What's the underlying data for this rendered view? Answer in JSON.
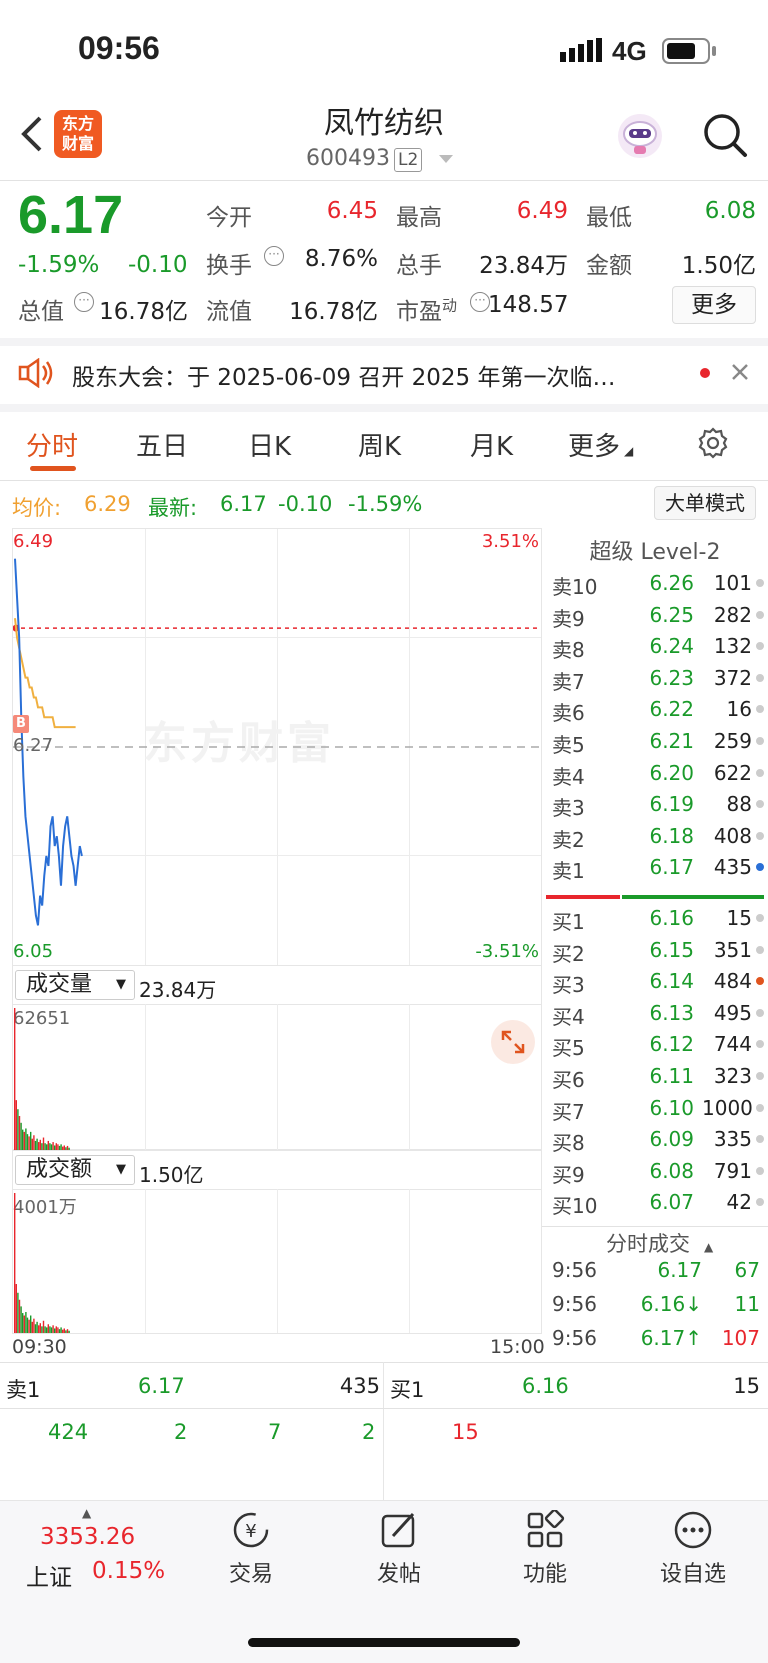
{
  "status": {
    "time": "09:56",
    "network": "4G"
  },
  "header": {
    "logo_line1": "东方",
    "logo_line2": "财富",
    "title": "凤竹纺织",
    "code": "600493",
    "level": "L2"
  },
  "quote": {
    "price": "6.17",
    "change_pct": "-1.59%",
    "change": "-0.10",
    "open_label": "今开",
    "open": "6.45",
    "high_label": "最高",
    "high": "6.49",
    "low_label": "最低",
    "low": "6.08",
    "turnover_label": "换手",
    "turnover": "8.76%",
    "volume_label": "总手",
    "volume": "23.84万",
    "amount_label": "金额",
    "amount": "1.50亿",
    "mktcap_label": "总值",
    "mktcap": "16.78亿",
    "float_label": "流值",
    "float": "16.78亿",
    "pe_label": "市盈",
    "pe_sup": "动",
    "pe": "148.57",
    "more_button": "更多"
  },
  "notice": {
    "text": "股东大会：于 2025-06-09 召开 2025 年第一次临…"
  },
  "tabs": [
    "分时",
    "五日",
    "日K",
    "周K",
    "月K",
    "更多"
  ],
  "chart_info": {
    "avg_label": "均价:",
    "avg": "6.29",
    "latest_label": "最新:",
    "latest": "6.17",
    "latest_change": "-0.10",
    "latest_pct": "-1.59%",
    "mode_button": "大单模式"
  },
  "chart_data": {
    "type": "line",
    "y_top": "6.49",
    "y_mid": "6.27",
    "y_bottom": "6.05",
    "pct_top": "3.51%",
    "pct_bottom": "-3.51%",
    "time_start": "09:30",
    "time_end": "15:00",
    "watermark": "东方财富",
    "marker": "B",
    "price_line": [
      6.46,
      6.42,
      6.38,
      6.3,
      6.24,
      6.2,
      6.18,
      6.16,
      6.14,
      6.12,
      6.1,
      6.09,
      6.12,
      6.11,
      6.14,
      6.16,
      6.15,
      6.19,
      6.2,
      6.17,
      6.18,
      6.16,
      6.13,
      6.17,
      6.19,
      6.2,
      6.18,
      6.16,
      6.15,
      6.13,
      6.15,
      6.17,
      6.16
    ],
    "avg_line": [
      6.4,
      6.38,
      6.37,
      6.36,
      6.35,
      6.34,
      6.34,
      6.33,
      6.33,
      6.32,
      6.32,
      6.31,
      6.31,
      6.31,
      6.3,
      6.3,
      6.3,
      6.3,
      6.3,
      6.29,
      6.29,
      6.29,
      6.29,
      6.29,
      6.29,
      6.29,
      6.29,
      6.29,
      6.29,
      6.29
    ],
    "prev_close": 6.27,
    "last_price": 6.17,
    "y_range": [
      6.05,
      6.49
    ]
  },
  "volume_panel": {
    "label": "成交量",
    "value": "23.84万",
    "max": "62651",
    "bars": [
      62651,
      22000,
      18000,
      15000,
      12000,
      9000,
      8000,
      9500,
      7000,
      6000,
      8000,
      5000,
      6500,
      4000,
      5000,
      3500,
      4500,
      3000,
      5500,
      3000,
      2500,
      4000,
      3000,
      2500,
      3500,
      2000,
      3000,
      2500,
      1800,
      2500,
      1500,
      2000,
      1200,
      1800,
      1000
    ]
  },
  "amount_panel": {
    "label": "成交额",
    "value": "1.50亿",
    "max": "4001万",
    "bars": [
      40010,
      14000,
      11500,
      9500,
      7600,
      5700,
      5000,
      6000,
      4400,
      3800,
      5000,
      3200,
      4100,
      2500,
      3200,
      2200,
      2800,
      1900,
      3500,
      1900,
      1600,
      2500,
      1900,
      1600,
      2200,
      1300,
      1900,
      1600,
      1100,
      1600,
      950,
      1300,
      760,
      1100,
      640
    ]
  },
  "orderbook": {
    "title": "超级 Level-2",
    "asks": [
      {
        "label": "卖10",
        "price": "6.26",
        "vol": "101"
      },
      {
        "label": "卖9",
        "price": "6.25",
        "vol": "282"
      },
      {
        "label": "卖8",
        "price": "6.24",
        "vol": "132"
      },
      {
        "label": "卖7",
        "price": "6.23",
        "vol": "372"
      },
      {
        "label": "卖6",
        "price": "6.22",
        "vol": "16"
      },
      {
        "label": "卖5",
        "price": "6.21",
        "vol": "259"
      },
      {
        "label": "卖4",
        "price": "6.20",
        "vol": "622"
      },
      {
        "label": "卖3",
        "price": "6.19",
        "vol": "88"
      },
      {
        "label": "卖2",
        "price": "6.18",
        "vol": "408"
      },
      {
        "label": "卖1",
        "price": "6.17",
        "vol": "435"
      }
    ],
    "bids": [
      {
        "label": "买1",
        "price": "6.16",
        "vol": "15"
      },
      {
        "label": "买2",
        "price": "6.15",
        "vol": "351"
      },
      {
        "label": "买3",
        "price": "6.14",
        "vol": "484"
      },
      {
        "label": "买4",
        "price": "6.13",
        "vol": "495"
      },
      {
        "label": "买5",
        "price": "6.12",
        "vol": "744"
      },
      {
        "label": "买6",
        "price": "6.11",
        "vol": "323"
      },
      {
        "label": "买7",
        "price": "6.10",
        "vol": "1000"
      },
      {
        "label": "买8",
        "price": "6.09",
        "vol": "335"
      },
      {
        "label": "买9",
        "price": "6.08",
        "vol": "791"
      },
      {
        "label": "买10",
        "price": "6.07",
        "vol": "42"
      }
    ],
    "ticks_title": "分时成交",
    "ticks": [
      {
        "time": "9:56",
        "price": "6.17",
        "vol": "67"
      },
      {
        "time": "9:56",
        "price": "6.16↓",
        "vol": "11"
      },
      {
        "time": "9:56",
        "price": "6.17↑",
        "vol": "107"
      }
    ]
  },
  "queue": {
    "ask_label": "卖1",
    "ask_price": "6.17",
    "ask_vol": "435",
    "bid_label": "买1",
    "bid_price": "6.16",
    "bid_vol": "15",
    "ask_orders": [
      "424",
      "2",
      "7",
      "2"
    ],
    "bid_orders": [
      "15"
    ]
  },
  "bottom_nav": {
    "index_value": "3353.26",
    "index_name": "上证",
    "index_pct": "0.15%",
    "trade": "交易",
    "post": "发帖",
    "functions": "功能",
    "watchlist": "设自选"
  },
  "colors": {
    "up": "#e8262d",
    "down": "#1a9a2a",
    "accent": "#e0541e",
    "price_line": "#2a6fd6",
    "avg_line": "#f0b040"
  }
}
